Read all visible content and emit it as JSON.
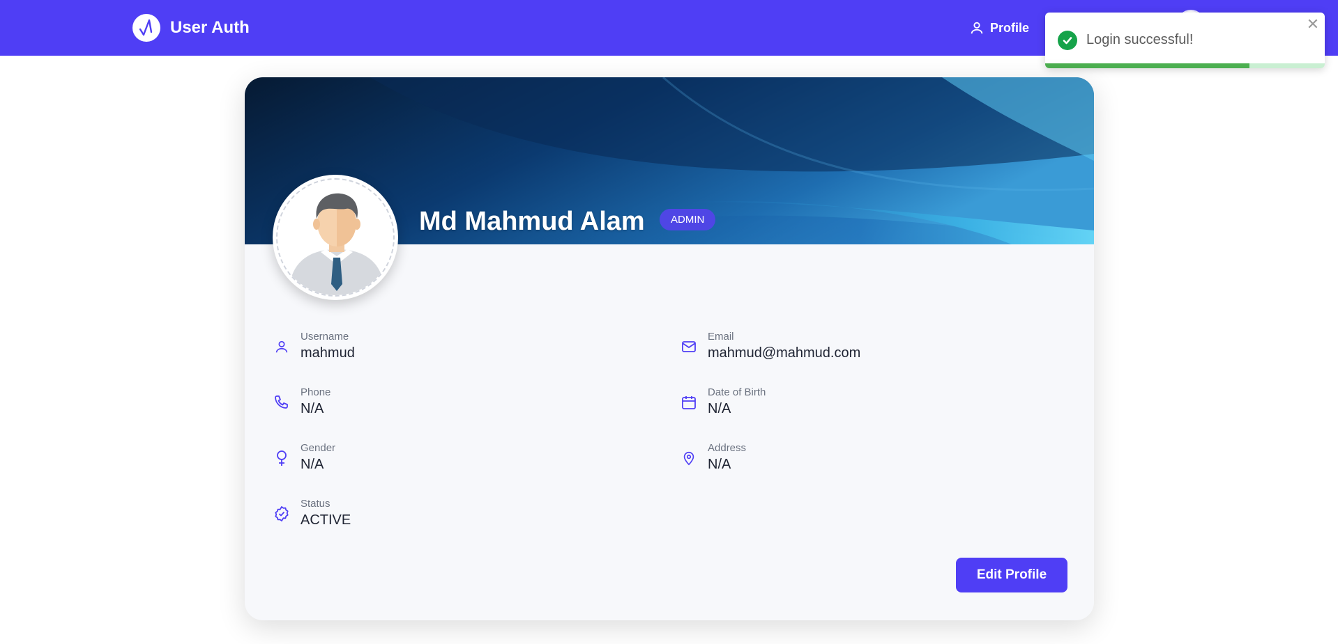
{
  "navbar": {
    "brand_title": "User Auth",
    "profile_label": "Profile",
    "background_color": "#4f3ef5"
  },
  "toast": {
    "message": "Login successful!",
    "close_glyph": "✕",
    "progress": 0.73,
    "icon": "check-circle-icon"
  },
  "profile": {
    "name": "Md Mahmud Alam",
    "role": "ADMIN",
    "fields": [
      {
        "label": "Username",
        "value": "mahmud",
        "icon": "user-icon"
      },
      {
        "label": "Email",
        "value": "mahmud@mahmud.com",
        "icon": "mail-icon"
      },
      {
        "label": "Phone",
        "value": "N/A",
        "icon": "phone-icon"
      },
      {
        "label": "Date of Birth",
        "value": "N/A",
        "icon": "calendar-icon"
      },
      {
        "label": "Gender",
        "value": "N/A",
        "icon": "female-icon"
      },
      {
        "label": "Address",
        "value": "N/A",
        "icon": "map-pin-icon"
      },
      {
        "label": "Status",
        "value": "ACTIVE",
        "icon": "verified-badge-icon"
      }
    ],
    "edit_button_label": "Edit Profile"
  },
  "colors": {
    "accent": "#4f3ef5",
    "badge": "#4f46e5",
    "success": "#16a34a"
  }
}
